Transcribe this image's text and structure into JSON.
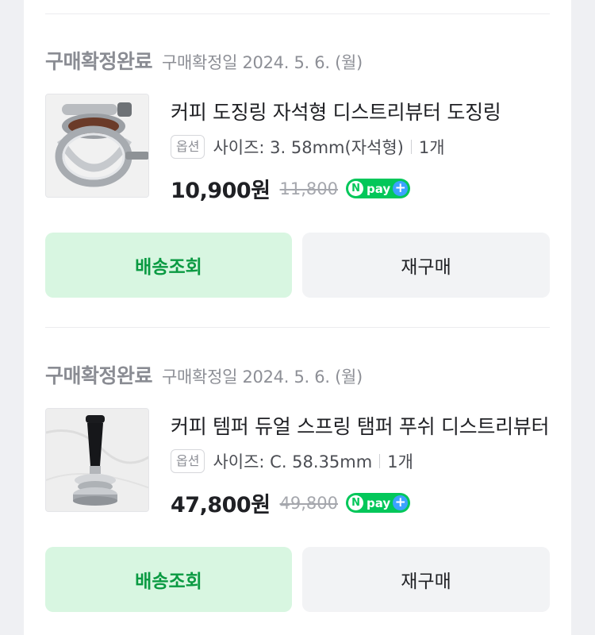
{
  "orders": [
    {
      "status": "구매확정완료",
      "date": "구매확정일 2024. 5. 6. (월)",
      "title": "커피 도징링 자석형 디스트리뷰터 도징링",
      "option_badge": "옵션",
      "option_text": "사이즈: 3. 58mm(자석형)",
      "quantity": "1개",
      "price": "10,900원",
      "original_price": "11,800",
      "npay": {
        "n": "N",
        "pay": "pay",
        "plus": "+"
      },
      "track_button": "배송조회",
      "rebuy_button": "재구매",
      "thumbnail": "dosing-ring-photo"
    },
    {
      "status": "구매확정완료",
      "date": "구매확정일 2024. 5. 6. (월)",
      "title": "커피 템퍼 듀얼 스프링 탬퍼 푸쉬 디스트리뷰터",
      "option_badge": "옵션",
      "option_text": "사이즈: C. 58.35mm",
      "quantity": "1개",
      "price": "47,800원",
      "original_price": "49,800",
      "npay": {
        "n": "N",
        "pay": "pay",
        "plus": "+"
      },
      "track_button": "배송조회",
      "rebuy_button": "재구매",
      "thumbnail": "tamper-photo"
    }
  ],
  "colors": {
    "background": "#eff0f3",
    "card": "#ffffff",
    "track_button_bg": "#d8f6e1",
    "track_button_text": "#0a9a42",
    "rebuy_button_bg": "#f2f3f5",
    "npay_green": "#03c75a",
    "npay_plus_blue": "#3ca2ff"
  }
}
